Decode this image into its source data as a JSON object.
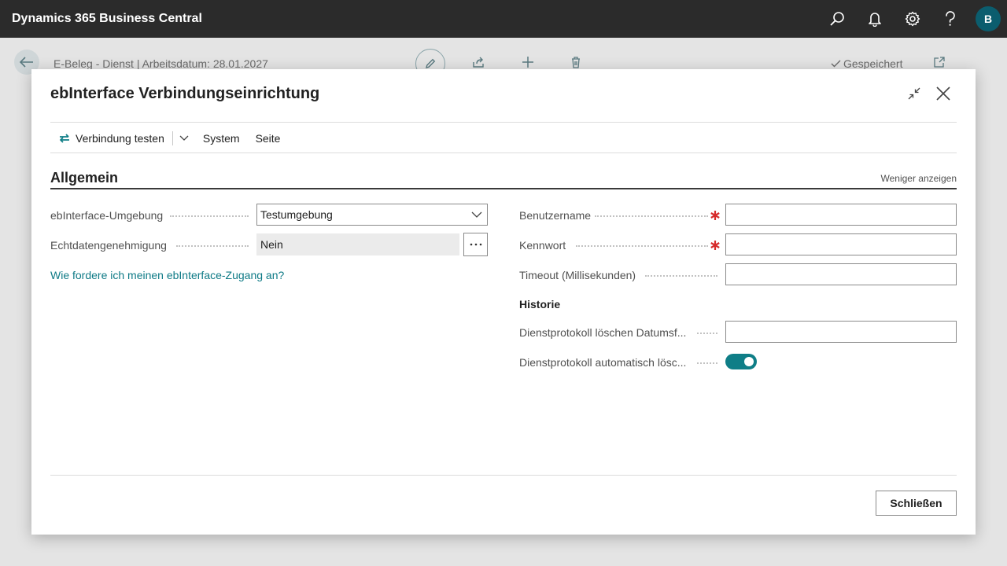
{
  "app": {
    "title": "Dynamics 365 Business Central",
    "avatar_initial": "B"
  },
  "topbar_icons": [
    "search-icon",
    "bell-icon",
    "gear-icon",
    "help-icon"
  ],
  "background_page": {
    "title": "E-Beleg - Dienst | Arbeitsdatum: 28.01.2027",
    "saved_label": "Gespeichert"
  },
  "dialog": {
    "title": "ebInterface Verbindungseinrichtung",
    "actions": {
      "test_connection": "Verbindung testen",
      "system": "System",
      "page": "Seite"
    },
    "section": {
      "title": "Allgemein",
      "show_less": "Weniger anzeigen"
    },
    "fields": {
      "environment_label": "ebInterface-Umgebung",
      "environment_value": "Testumgebung",
      "approval_label": "Echtdatengenehmigung",
      "approval_value": "Nein",
      "access_link": "Wie fordere ich meinen ebInterface-Zugang an?",
      "username_label": "Benutzername",
      "username_value": "",
      "password_label": "Kennwort",
      "password_value": "",
      "timeout_label": "Timeout (Millisekunden)",
      "timeout_value": ""
    },
    "history": {
      "title": "Historie",
      "delete_date_label": "Dienstprotokoll löschen Datumsf...",
      "delete_date_value": "",
      "auto_delete_label": "Dienstprotokoll automatisch lösc...",
      "auto_delete_on": true
    },
    "close_button": "Schließen"
  },
  "colors": {
    "accent": "#0f7e87",
    "link": "#0e7a86",
    "required": "#d62b2b",
    "topbar": "#2b2b2b"
  }
}
